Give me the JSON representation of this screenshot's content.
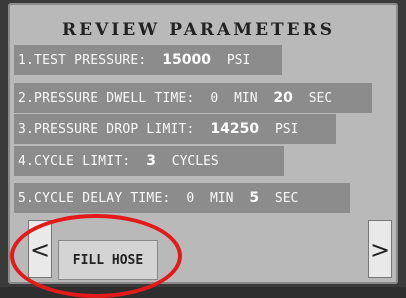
{
  "title": "REVIEW PARAMETERS",
  "params": [
    {
      "label": "1.TEST PRESSURE:",
      "value": "15000",
      "unit": "PSI"
    },
    {
      "label": "2.PRESSURE DWELL TIME:",
      "min_value": "0",
      "min_unit": "MIN",
      "sec_value": "20",
      "sec_unit": "SEC"
    },
    {
      "label": "3.PRESSURE DROP LIMIT:",
      "value": "14250",
      "unit": "PSI"
    },
    {
      "label": "4.CYCLE LIMIT:",
      "value": "3",
      "unit": "CYCLES"
    },
    {
      "label": "5.CYCLE DELAY TIME:",
      "min_value": "0",
      "min_unit": "MIN",
      "sec_value": "5",
      "sec_unit": "SEC"
    }
  ],
  "buttons": {
    "prev": "<",
    "next": ">",
    "fill_hose": "FILL HOSE"
  },
  "colors": {
    "callout": "#e21a1a",
    "row_bg": "#8c8c8c",
    "screen_bg": "#b9b9b9"
  }
}
